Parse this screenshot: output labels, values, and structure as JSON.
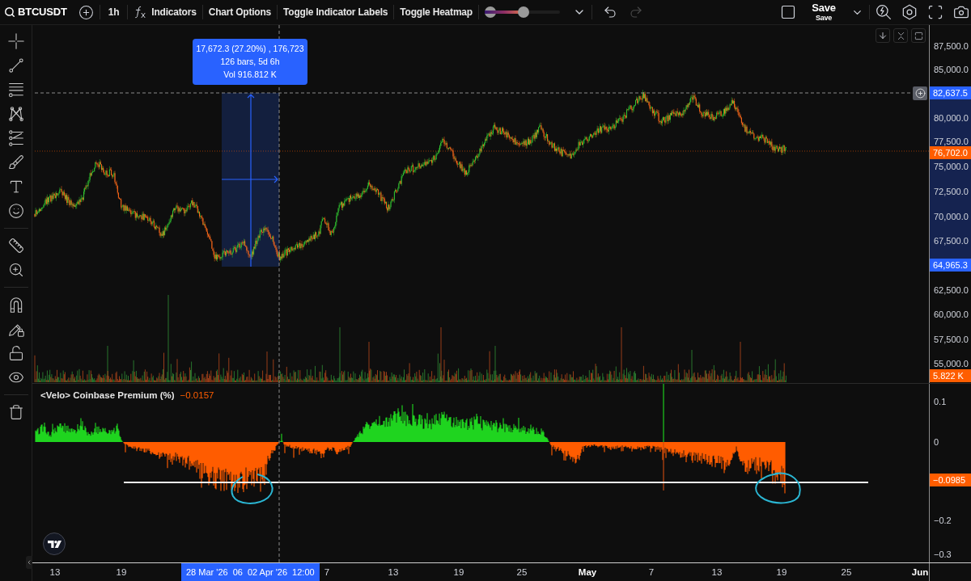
{
  "toolbar": {
    "symbol": "BTCUSDT",
    "interval": "1h",
    "buttons": [
      {
        "kind": "indicators",
        "label": "Indicators"
      },
      {
        "kind": "plain",
        "label": "Chart Options"
      },
      {
        "kind": "plain",
        "label": "Toggle Indicator Labels"
      },
      {
        "kind": "plain",
        "label": "Toggle Heatmap"
      }
    ],
    "heatmap_slider": {
      "level": 0.52
    },
    "history": [
      {
        "kind": "undo",
        "disabled": false
      },
      {
        "kind": "redo",
        "disabled": true
      }
    ],
    "save": {
      "title": "Save",
      "subtitle": "Save"
    }
  },
  "price_pane": {
    "measurement": [
      "17,672.3 (27.20%) , 176,723",
      "126 bars, 5d 6h",
      "Vol 916.812 K"
    ],
    "axis_ticks": [
      "87,500.0",
      "85,000.0",
      "80,000.0",
      "77,500.0",
      "75,000.0",
      "72,500.0",
      "70,000.0",
      "67,500.0",
      "62,500.0",
      "60,000.0",
      "57,500.0",
      "55,000.0"
    ],
    "axis_markers": [
      {
        "kind": "crosshair",
        "label": "82,637.5"
      },
      {
        "kind": "last_price",
        "label": "76,702.0"
      },
      {
        "kind": "range_end",
        "label": "64,965.3"
      },
      {
        "kind": "volume",
        "label": "5.822 K"
      }
    ]
  },
  "indicator_pane": {
    "title": "<Velo> Coinbase Premium (%)",
    "value": "−0.0157",
    "axis_ticks": [
      "0.1",
      "0",
      "−0.2",
      "−0.3"
    ],
    "axis_markers": [
      {
        "kind": "line_value",
        "label": "−0.0985"
      }
    ]
  },
  "time_axis": {
    "ticks": [
      {
        "kind": "day",
        "label": "13"
      },
      {
        "kind": "day",
        "label": "19"
      },
      {
        "kind": "day",
        "label": "7"
      },
      {
        "kind": "day",
        "label": "13"
      },
      {
        "kind": "day",
        "label": "19"
      },
      {
        "kind": "day",
        "label": "25"
      },
      {
        "kind": "month",
        "label": "May"
      },
      {
        "kind": "day",
        "label": "7"
      },
      {
        "kind": "day",
        "label": "13"
      },
      {
        "kind": "day",
        "label": "19"
      },
      {
        "kind": "day",
        "label": "25"
      },
      {
        "kind": "month",
        "label": "Jun"
      }
    ],
    "range_label": [
      "28 Mar '26",
      "06",
      "02 Apr '26",
      "12:00"
    ]
  }
}
